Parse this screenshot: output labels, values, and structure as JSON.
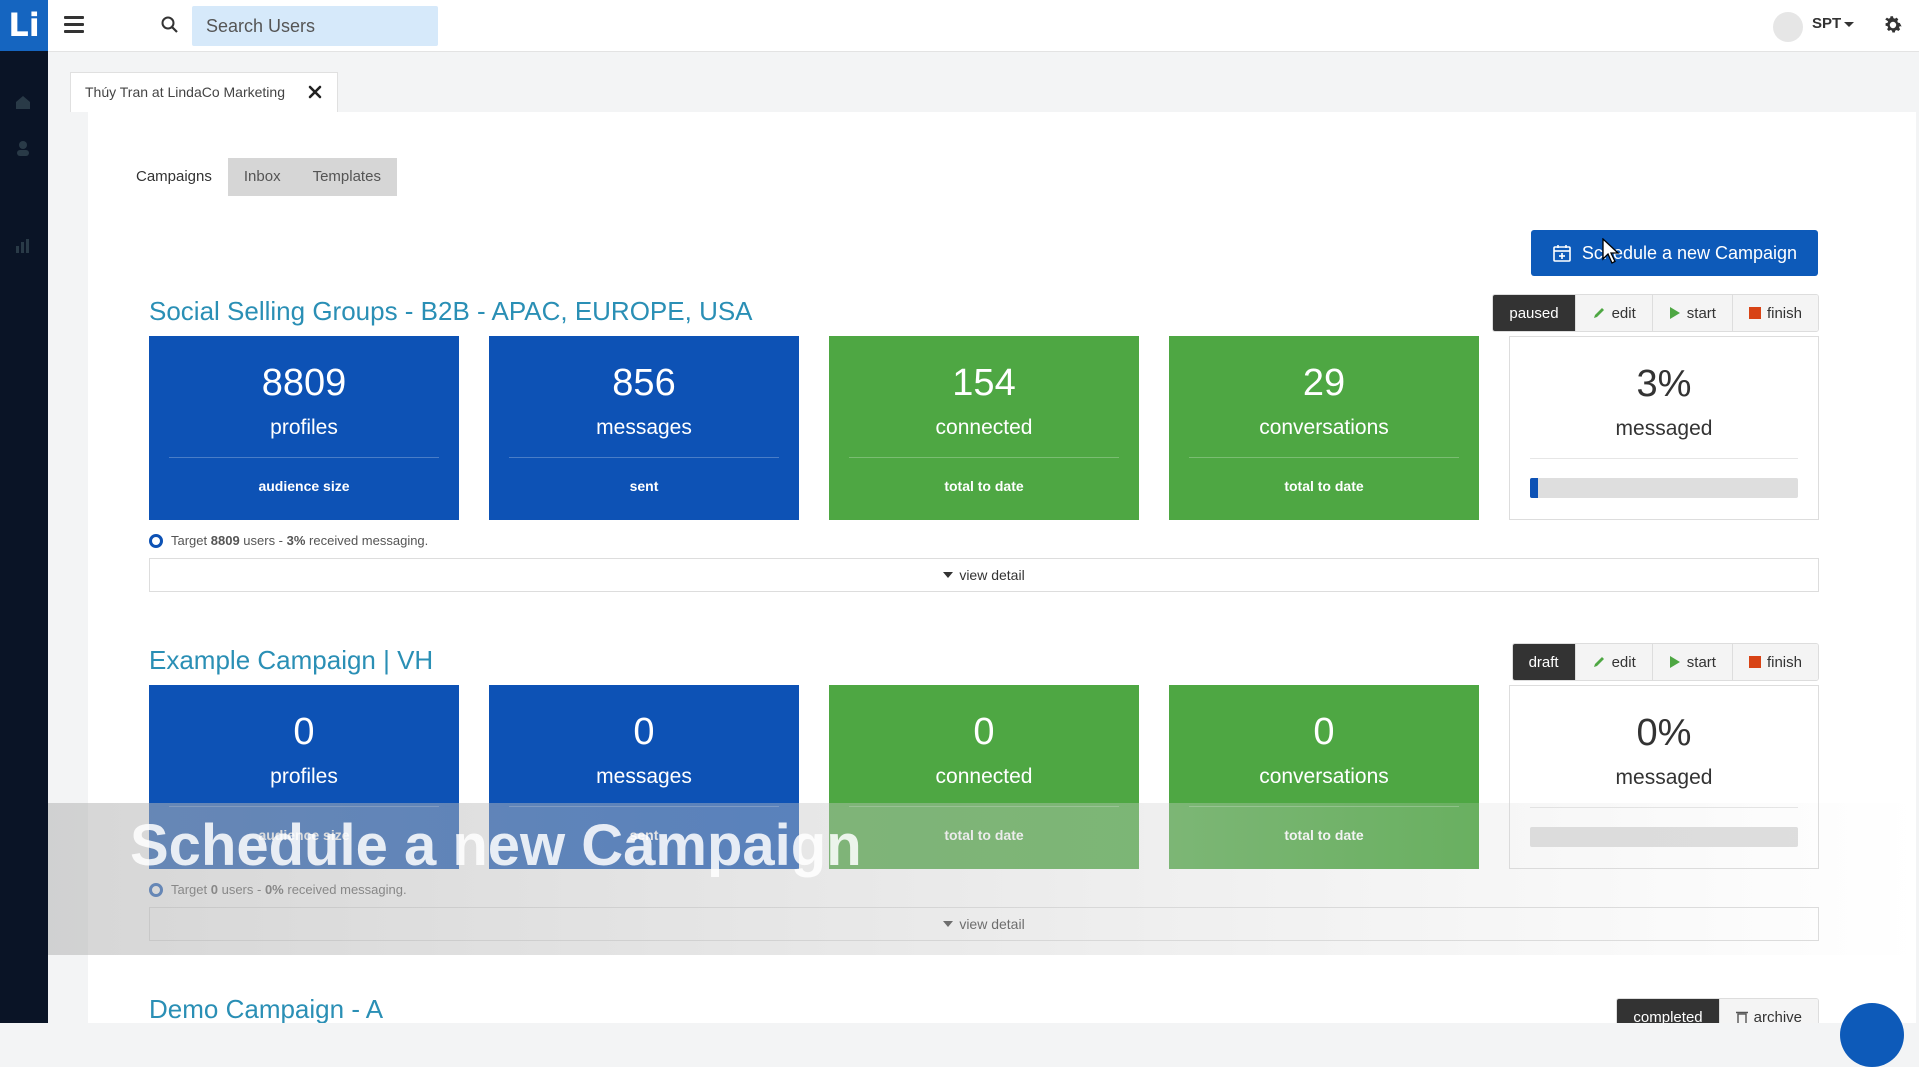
{
  "app": {
    "logo_text": "Li"
  },
  "search": {
    "placeholder": "Search Users"
  },
  "user_menu": {
    "label": "SPT"
  },
  "record_tab": {
    "label": "Thúy Tran at LindaCo Marketing"
  },
  "subtabs": [
    "Campaigns",
    "Inbox",
    "Templates"
  ],
  "schedule_button": {
    "label": "Schedule a new Campaign"
  },
  "campaigns": [
    {
      "title": "Social Selling Groups - B2B - APAC, EUROPE, USA",
      "status": "paused",
      "actions": [
        "edit",
        "start",
        "finish"
      ],
      "stats": [
        {
          "value": "8809",
          "unit": "profiles",
          "footer": "audience size"
        },
        {
          "value": "856",
          "unit": "messages",
          "footer": "sent"
        },
        {
          "value": "154",
          "unit": "connected",
          "footer": "total to date"
        },
        {
          "value": "29",
          "unit": "conversations",
          "footer": "total to date"
        },
        {
          "value": "3%",
          "unit": "messaged",
          "progress": 0.03
        }
      ],
      "target": {
        "pre": "Target ",
        "count": "8809",
        "mid": " users - ",
        "percent": "3%",
        "post": " received messaging."
      },
      "view_detail": "view detail"
    },
    {
      "title": "Example Campaign | VH",
      "status": "draft",
      "actions": [
        "edit",
        "start",
        "finish"
      ],
      "stats": [
        {
          "value": "0",
          "unit": "profiles",
          "footer": "audience size"
        },
        {
          "value": "0",
          "unit": "messages",
          "footer": "sent"
        },
        {
          "value": "0",
          "unit": "connected",
          "footer": "total to date"
        },
        {
          "value": "0",
          "unit": "conversations",
          "footer": "total to date"
        },
        {
          "value": "0%",
          "unit": "messaged",
          "progress": 0
        }
      ],
      "target": {
        "pre": "Target ",
        "count": "0",
        "mid": " users - ",
        "percent": "0%",
        "post": " received messaging."
      },
      "view_detail": "view detail"
    },
    {
      "title": "Demo Campaign - A",
      "status": "completed",
      "actions": [
        "archive"
      ]
    }
  ],
  "overlay_caption": "Schedule a new Campaign",
  "colors": {
    "brand_blue": "#0d52b5",
    "accent_green": "#4ea743",
    "title_teal": "#2a8fb5",
    "sidebar": "#0a1426"
  }
}
